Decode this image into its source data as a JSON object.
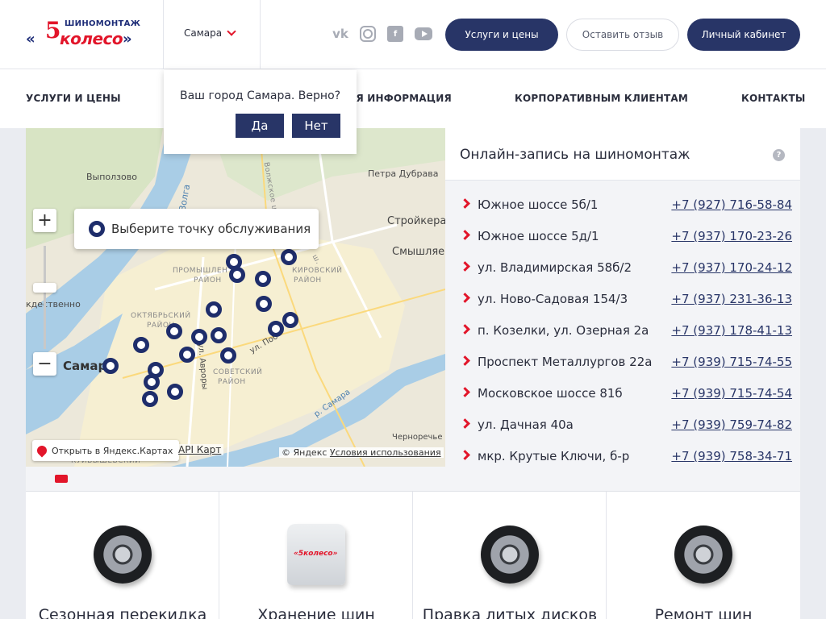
{
  "header": {
    "logo_top": "ШИНОМОНТАЖ",
    "logo_five": "5",
    "logo_name": "колесо",
    "city": "Самара",
    "socials": [
      "vk-icon",
      "instagram-icon",
      "facebook-icon",
      "youtube-icon"
    ],
    "btn_services": "Услуги и цены",
    "btn_review": "Оставить отзыв",
    "btn_cabinet": "Личный кабинет"
  },
  "nav": {
    "items": [
      "УСЛУГИ И ЦЕНЫ",
      "ПОЛЕЗНАЯ ИНФОРМАЦИЯ",
      "КОРПОРАТИВНЫМ КЛИЕНТАМ",
      "КОНТАКТЫ"
    ],
    "info_visible": "АЯ ИНФОРМАЦИЯ"
  },
  "city_popup": {
    "question": "Ваш город Самара. Верно?",
    "yes": "Да",
    "no": "Нет"
  },
  "map": {
    "choose_label": "Выберите точку обслуживания",
    "labels": {
      "vypolzovo": "Выползово",
      "petra_dubrava": "Петра Дубрава",
      "stroykera": "Стройкера",
      "smyshlyae": "Смышляе",
      "volga": "Волга",
      "volzhskoe": "Волжское ш.",
      "promyshl": "ПРОМЫШЛЕН",
      "rayon1": "РАЙОН",
      "kirovsky": "КИРОВСКИЙ",
      "rayon2": "РАЙОН",
      "oktyabrsky": "ОКТЯБРЬСКИЙ",
      "rayon3": "РАЙОН",
      "sovetsky": "СОВЕТСКИЙ",
      "rayon4": "РАЙОН",
      "samara": "Самар",
      "kdestvenno": "кдественно",
      "ul_avrory": "ул. Авроры",
      "ul_pob": "ул. Поб",
      "r_samara": "р. Самара",
      "chernorechye": "Черноречье",
      "kuybyshevsky": "КУЙБЫШЕВСКИЙ",
      "shosse": "ш."
    },
    "open_yandex": "Открыть в Яндекс.Картах",
    "api": "API Карт",
    "copyright": "© Яндекс",
    "terms": "Условия использования"
  },
  "booking": {
    "title": "Онлайн-запись на шиномонтаж",
    "help": "?",
    "locations": [
      {
        "address": "Южное шоссе 5б/1",
        "phone": "+7 (927) 716-58-84"
      },
      {
        "address": "Южное шоссе 5д/1",
        "phone": "+7 (937) 170-23-26"
      },
      {
        "address": "ул. Владимирская 58б/2",
        "phone": "+7 (937) 170-24-12"
      },
      {
        "address": "ул. Ново-Садовая 154/3",
        "phone": "+7 (937) 231-36-13"
      },
      {
        "address": "п. Козелки, ул. Озерная 2а",
        "phone": "+7 (937) 178-41-13"
      },
      {
        "address": "Проспект Металлургов 22а",
        "phone": "+7 (939) 715-74-55"
      },
      {
        "address": "Московское шоссе 81б",
        "phone": "+7 (939) 715-74-54"
      },
      {
        "address": "ул. Дачная 40а",
        "phone": "+7 (939) 759-74-82"
      },
      {
        "address": "мкр. Крутые Ключи, б-р",
        "phone": "+7 (939) 758-34-71"
      }
    ]
  },
  "services": [
    {
      "name": "Сезонная перекидка",
      "icon": "tire-icon"
    },
    {
      "name": "Хранение шин",
      "icon": "tire-bag-icon"
    },
    {
      "name": "Правка литых дисков",
      "icon": "alloy-wheel-icon"
    },
    {
      "name": "Ремонт шин",
      "icon": "tire-icon"
    }
  ],
  "colors": {
    "brand_navy": "#283567",
    "brand_red": "#e2152a",
    "pin": "#1e2d6b"
  }
}
